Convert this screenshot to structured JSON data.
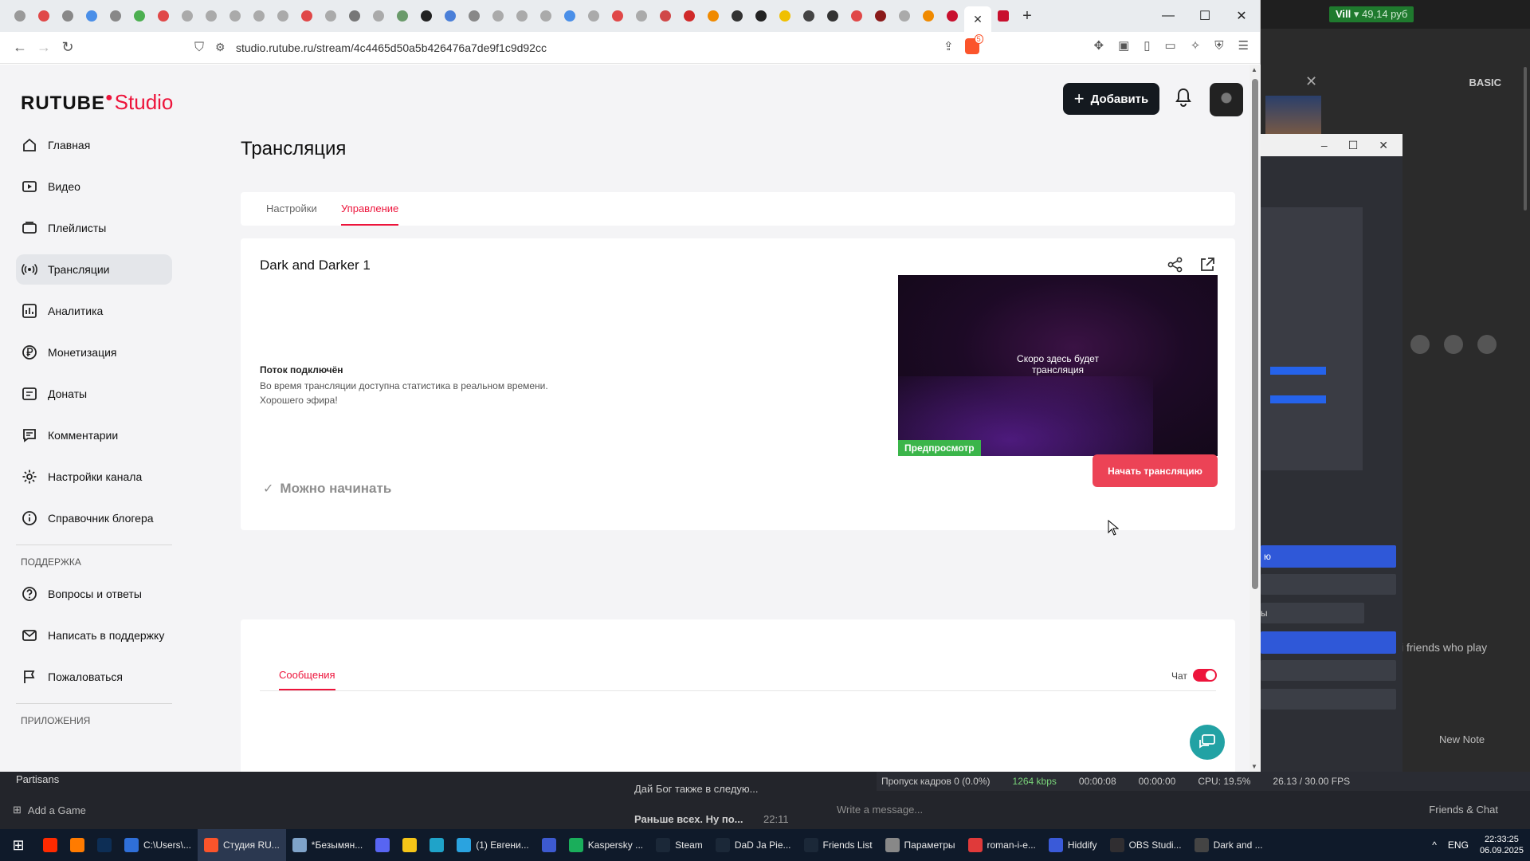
{
  "browser": {
    "url": "studio.rutube.ru/stream/4c4465d50a5b426476a7de9f1c9d92cc",
    "brave_badge": "5"
  },
  "header": {
    "logo_main": "RUTUBE",
    "logo_sub": "Studio",
    "add_label": "Добавить"
  },
  "sidebar": {
    "items": [
      {
        "label": "Главная",
        "icon": "home-icon"
      },
      {
        "label": "Видео",
        "icon": "video-icon"
      },
      {
        "label": "Плейлисты",
        "icon": "playlist-icon"
      },
      {
        "label": "Трансляции",
        "icon": "broadcast-icon"
      },
      {
        "label": "Аналитика",
        "icon": "analytics-icon"
      },
      {
        "label": "Монетизация",
        "icon": "ruble-icon"
      },
      {
        "label": "Донаты",
        "icon": "donate-icon"
      },
      {
        "label": "Комментарии",
        "icon": "comment-icon"
      },
      {
        "label": "Настройки канала",
        "icon": "gear-icon"
      },
      {
        "label": "Справочник блогера",
        "icon": "info-icon"
      }
    ],
    "support_heading": "ПОДДЕРЖКА",
    "support_items": [
      {
        "label": "Вопросы и ответы"
      },
      {
        "label": "Написать в поддержку"
      },
      {
        "label": "Пожаловаться"
      }
    ],
    "apps_heading": "ПРИЛОЖЕНИЯ"
  },
  "main": {
    "title": "Трансляция",
    "tabs": [
      {
        "label": "Настройки"
      },
      {
        "label": "Управление"
      }
    ],
    "stream": {
      "name": "Dark and Darker 1",
      "status_title": "Поток подключён",
      "status_line1": "Во время трансляции доступна статистика в реальном времени.",
      "status_line2": "Хорошего эфира!",
      "preview_line1": "Скоро здесь будет",
      "preview_line2": "трансляция",
      "preview_badge": "Предпросмотр",
      "ready_label": "Можно начинать",
      "start_label": "Начать трансляцию"
    },
    "chat": {
      "tab_label": "Сообщения",
      "toggle_label": "Чат",
      "toggle_on": true
    }
  },
  "background": {
    "wallet_name": "Vill",
    "wallet_amount": "49,14 руб",
    "basic_label": "BASIC",
    "blue_item_1": "ю",
    "grey_label": "ы",
    "friends_text": "i friends who play",
    "new_note": "New Note",
    "obs_status": {
      "dropped": "Пропуск кадров 0 (0.0%)",
      "kbps": "1264 kbps",
      "time1": "00:00:08",
      "time2": "00:00:00",
      "cpu": "CPU: 19.5%",
      "fps": "26.13 / 30.00 FPS"
    },
    "partisans": "Partisans",
    "add_game": "Add a Game",
    "chat_msg1": "Дай Бог также в следую...",
    "chat_msg2": "Раньше всех. Ну по...",
    "chat_msg2_time": "22:11",
    "write_message": "Write a message...",
    "friends_chat": "Friends & Chat"
  },
  "taskbar": {
    "items": [
      {
        "label": "C:\\Users\\...",
        "color": "#2f6fd8"
      },
      {
        "label": "Студия RU...",
        "color": "#fb542b",
        "active": true
      },
      {
        "label": "*Безымян...",
        "color": "#7fa3c9"
      },
      {
        "label": "",
        "color": "#5865f2"
      },
      {
        "label": "",
        "color": "#f5c518"
      },
      {
        "label": "",
        "color": "#1fa3c9"
      },
      {
        "label": "(1) Евгени...",
        "color": "#2aa3e0"
      },
      {
        "label": "",
        "color": "#3d5ad0"
      },
      {
        "label": "Kaspersky ...",
        "color": "#1aae5b"
      },
      {
        "label": "Steam",
        "color": "#1b2838"
      },
      {
        "label": "DaD Ja Pie...",
        "color": "#1b2838"
      },
      {
        "label": "Friends List",
        "color": "#1b2838"
      },
      {
        "label": "Параметры",
        "color": "#888888"
      },
      {
        "label": "roman-i-e...",
        "color": "#e03a3a"
      },
      {
        "label": "Hiddify",
        "color": "#3a5ad8"
      },
      {
        "label": "OBS Studi...",
        "color": "#302e31"
      },
      {
        "label": "Dark and ...",
        "color": "#444444"
      }
    ],
    "lang": "ENG",
    "time": "22:33:25",
    "date": "06.09.2025"
  },
  "colors": {
    "accent": "#ed143b",
    "start_button": "#ec4356",
    "preview_badge": "#3bb54a",
    "support_fab": "#22a2a4"
  }
}
